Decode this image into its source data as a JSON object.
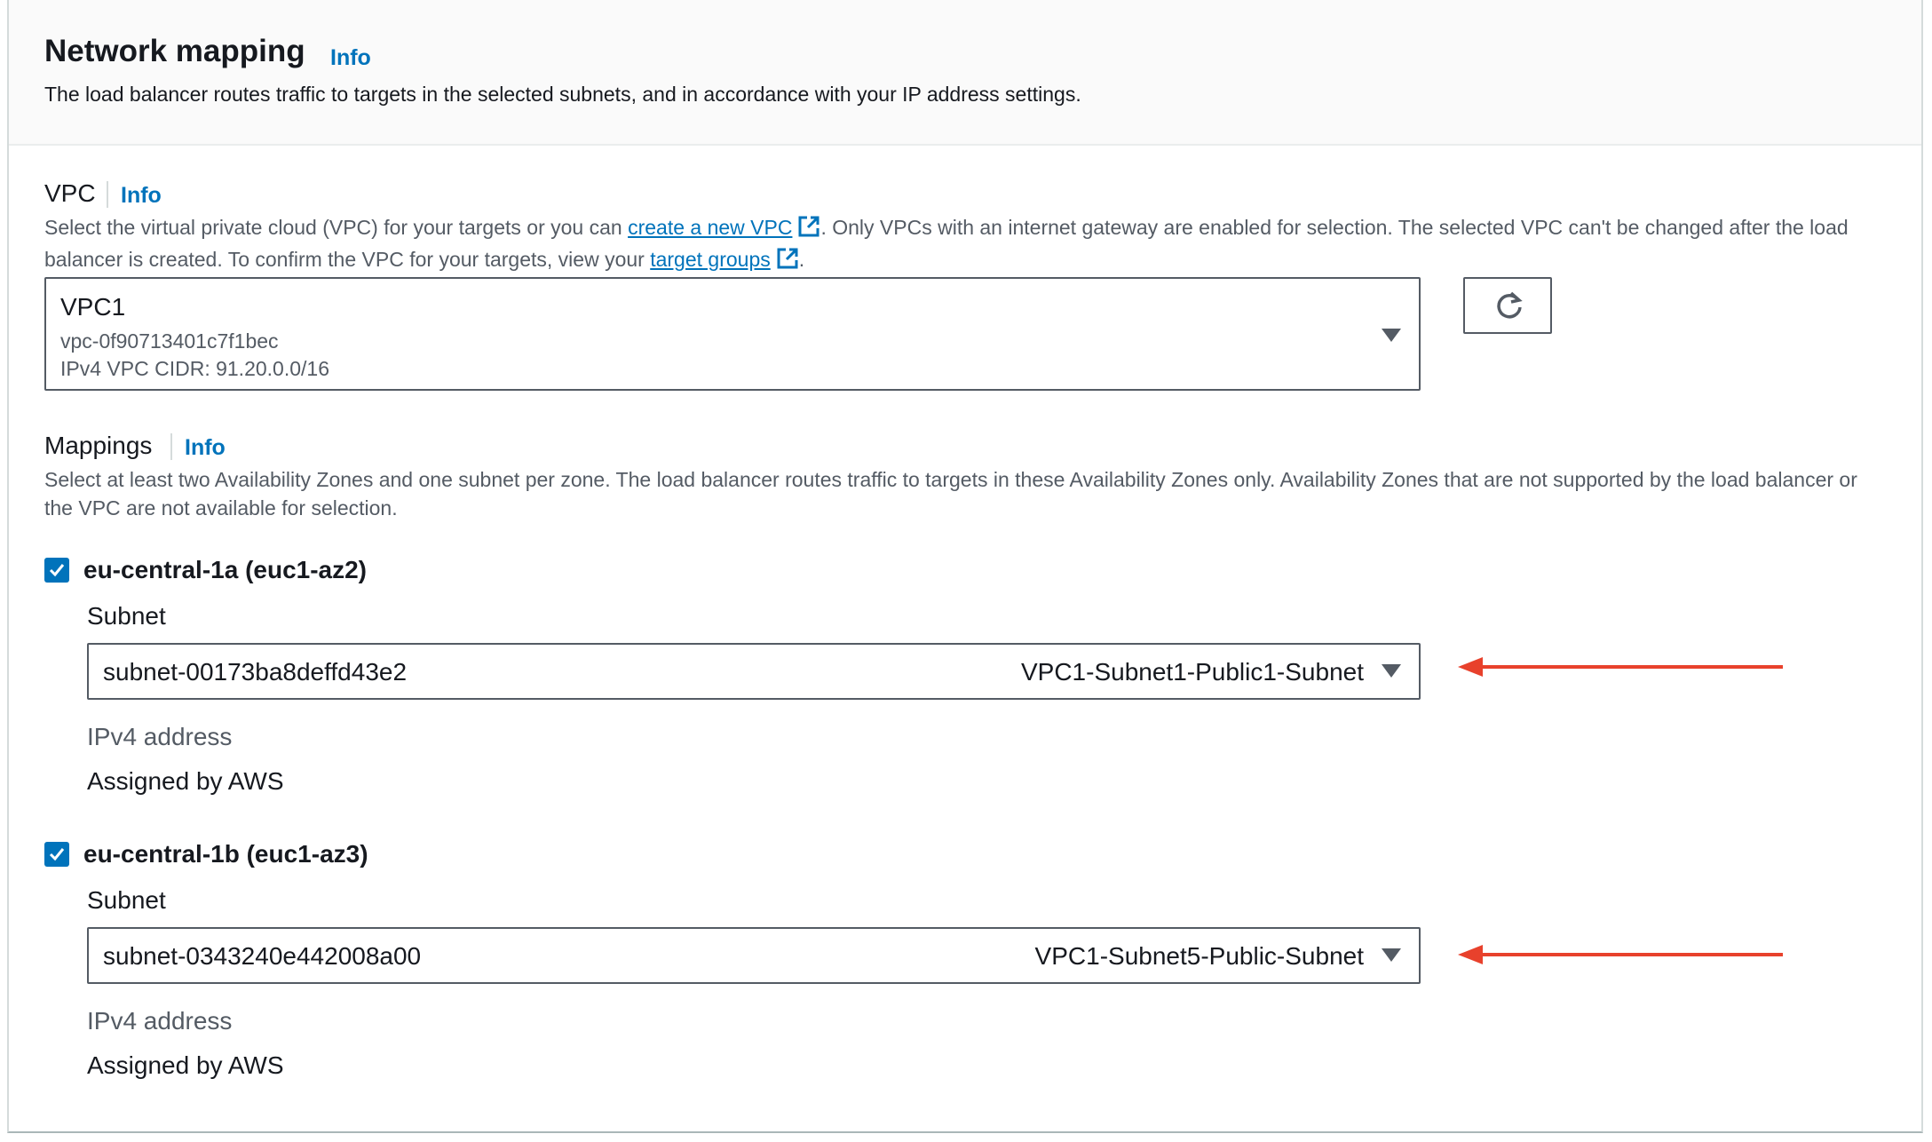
{
  "header": {
    "title": "Network mapping",
    "info": "Info",
    "description": "The load balancer routes traffic to targets in the selected subnets, and in accordance with your IP address settings."
  },
  "vpc": {
    "label": "VPC",
    "info": "Info",
    "desc_part1": "Select the virtual private cloud (VPC) for your targets or you can ",
    "link_create": "create a new VPC",
    "desc_part2": ". Only VPCs with an internet gateway are enabled for selection. The selected VPC can't be changed after the load balancer is created. To confirm the VPC for your targets, view your ",
    "link_target_groups": "target groups",
    "desc_part3": ".",
    "selected": {
      "name": "VPC1",
      "id": "vpc-0f90713401c7f1bec",
      "cidr": "IPv4 VPC CIDR: 91.20.0.0/16"
    }
  },
  "mappings": {
    "label": "Mappings",
    "info": "Info",
    "description": "Select at least two Availability Zones and one subnet per zone. The load balancer routes traffic to targets in these Availability Zones only. Availability Zones that are not supported by the load balancer or the VPC are not available for selection.",
    "zones": [
      {
        "name": "eu-central-1a (euc1-az2)",
        "checked": true,
        "subnet_label": "Subnet",
        "subnet_id": "subnet-00173ba8deffd43e2",
        "subnet_name": "VPC1-Subnet1-Public1-Subnet",
        "ip_label": "IPv4 address",
        "ip_value": "Assigned by AWS"
      },
      {
        "name": "eu-central-1b (euc1-az3)",
        "checked": true,
        "subnet_label": "Subnet",
        "subnet_id": "subnet-0343240e442008a00",
        "subnet_name": "VPC1-Subnet5-Public-Subnet",
        "ip_label": "IPv4 address",
        "ip_value": "Assigned by AWS"
      }
    ]
  },
  "colors": {
    "link": "#0073bb",
    "checkbox": "#0073bb",
    "annotation_arrow": "#e8412c"
  }
}
